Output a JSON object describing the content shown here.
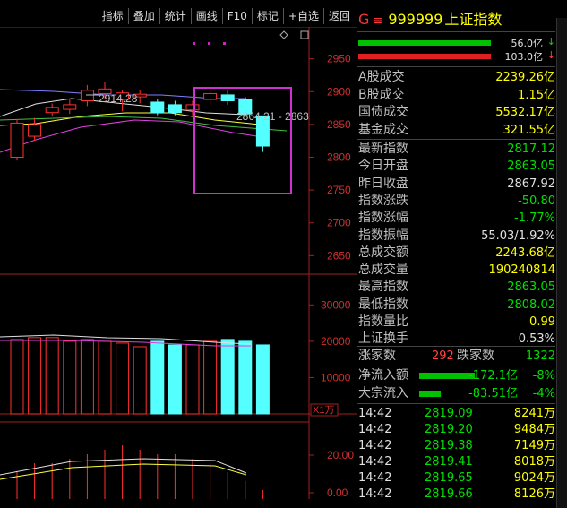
{
  "toolbar": {
    "buttons": [
      "指标",
      "叠加",
      "统计",
      "画线",
      "F10",
      "标记",
      "+自选",
      "返回"
    ]
  },
  "stock": {
    "g": "G",
    "menu": "≡",
    "code": "999999",
    "name": "上证指数"
  },
  "flow": {
    "in_label": "56.0亿",
    "out_label": "103.0亿"
  },
  "summary": [
    {
      "label": "A股成交",
      "value": "2239.26亿",
      "color": "yellow"
    },
    {
      "label": "B股成交",
      "value": "1.15亿",
      "color": "yellow"
    },
    {
      "label": "国债成交",
      "value": "5532.17亿",
      "color": "yellow"
    },
    {
      "label": "基金成交",
      "value": "321.55亿",
      "color": "yellow"
    }
  ],
  "quote": [
    {
      "label": "最新指数",
      "value": "2817.12",
      "color": "green"
    },
    {
      "label": "今日开盘",
      "value": "2863.05",
      "color": "green"
    },
    {
      "label": "昨日收盘",
      "value": "2867.92",
      "color": "white"
    },
    {
      "label": "指数涨跌",
      "value": "-50.80",
      "color": "green"
    },
    {
      "label": "指数涨幅",
      "value": "-1.77%",
      "color": "green"
    },
    {
      "label": "指数振幅",
      "value": "55.03/1.92%",
      "color": "white"
    },
    {
      "label": "总成交额",
      "value": "2243.68亿",
      "color": "yellow"
    },
    {
      "label": "总成交量",
      "value": "190240814",
      "color": "yellow"
    },
    {
      "label": "最高指数",
      "value": "2863.05",
      "color": "green"
    },
    {
      "label": "最低指数",
      "value": "2808.02",
      "color": "green"
    },
    {
      "label": "指数量比",
      "value": "0.99",
      "color": "yellow"
    },
    {
      "label": "上证换手",
      "value": "0.53%",
      "color": "white"
    }
  ],
  "updown": {
    "up_label": "涨家数",
    "up": "292",
    "down_label": "跌家数",
    "down": "1322"
  },
  "netflow": [
    {
      "label": "净流入额",
      "value": "-172.1亿",
      "pct": "-8%"
    },
    {
      "label": "大宗流入",
      "value": "-83.51亿",
      "pct": "-4%"
    }
  ],
  "ticks": [
    {
      "time": "14:42",
      "price": "2819.09",
      "vol": "8241万"
    },
    {
      "time": "14:42",
      "price": "2819.20",
      "vol": "9484万"
    },
    {
      "time": "14:42",
      "price": "2819.38",
      "vol": "7149万"
    },
    {
      "time": "14:42",
      "price": "2819.41",
      "vol": "8018万"
    },
    {
      "time": "14:42",
      "price": "2819.65",
      "vol": "9024万"
    },
    {
      "time": "14:42",
      "price": "2819.66",
      "vol": "8126万"
    }
  ],
  "chart_data": {
    "type": "candlestick",
    "price_axis": {
      "ticks": [
        2950,
        2900,
        2850,
        2800,
        2750,
        2700,
        2650
      ],
      "ylim": [
        2630,
        2985
      ]
    },
    "annotations": [
      "2914.28",
      "2864.21 - 2863"
    ],
    "candles": [
      {
        "o": 2800,
        "c": 2852,
        "h": 2858,
        "l": 2795,
        "dir": "up"
      },
      {
        "o": 2832,
        "c": 2850,
        "h": 2860,
        "l": 2825,
        "dir": "up"
      },
      {
        "o": 2868,
        "c": 2876,
        "h": 2882,
        "l": 2862,
        "dir": "up"
      },
      {
        "o": 2873,
        "c": 2880,
        "h": 2888,
        "l": 2866,
        "dir": "up"
      },
      {
        "o": 2886,
        "c": 2902,
        "h": 2910,
        "l": 2878,
        "dir": "up"
      },
      {
        "o": 2897,
        "c": 2904,
        "h": 2914,
        "l": 2890,
        "dir": "up"
      },
      {
        "o": 2888,
        "c": 2898,
        "h": 2903,
        "l": 2870,
        "dir": "up"
      },
      {
        "o": 2892,
        "c": 2896,
        "h": 2902,
        "l": 2882,
        "dir": "up"
      },
      {
        "o": 2884,
        "c": 2868,
        "h": 2888,
        "l": 2864,
        "dir": "down"
      },
      {
        "o": 2880,
        "c": 2868,
        "h": 2886,
        "l": 2864,
        "dir": "down"
      },
      {
        "o": 2872,
        "c": 2880,
        "h": 2886,
        "l": 2864,
        "dir": "up"
      },
      {
        "o": 2888,
        "c": 2897,
        "h": 2902,
        "l": 2880,
        "dir": "up"
      },
      {
        "o": 2895,
        "c": 2886,
        "h": 2902,
        "l": 2880,
        "dir": "down"
      },
      {
        "o": 2888,
        "c": 2866,
        "h": 2892,
        "l": 2862,
        "dir": "down"
      },
      {
        "o": 2863,
        "c": 2817,
        "h": 2863,
        "l": 2808,
        "dir": "down"
      }
    ],
    "volume_axis": {
      "ticks": [
        30000,
        20000,
        10000
      ],
      "unit": "X1万",
      "ylim": [
        0,
        36000
      ]
    },
    "volumes": [
      20500,
      21000,
      21000,
      20000,
      20500,
      20000,
      19500,
      18500,
      20000,
      19000,
      19000,
      20000,
      20500,
      20000,
      19000
    ],
    "indicator_axis": {
      "ticks": [
        "20.00",
        "0.00"
      ]
    }
  }
}
